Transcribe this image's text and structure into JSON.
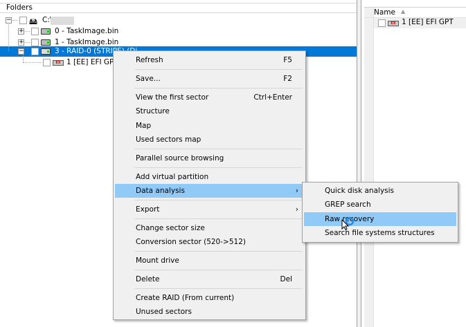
{
  "folders_header": "Folders",
  "tree": [
    {
      "label": "C:\\",
      "expander": "minus"
    },
    {
      "label": "0 - TaskImage.bin",
      "expander": "plus"
    },
    {
      "label": "1 - TaskImage.bin",
      "expander": "plus"
    },
    {
      "label": "3 - RAID-0 (STRIPE) (Di",
      "expander": "minus",
      "selected": true
    },
    {
      "label": "1 [EE] EFI GPT"
    }
  ],
  "list": {
    "column": "Name",
    "sort": "ascending",
    "rows": [
      {
        "label": "1 [EE] EFI GPT"
      }
    ]
  },
  "context_menu": {
    "items": [
      {
        "label": "Refresh",
        "shortcut": "F5"
      },
      {
        "label": "Save...",
        "shortcut": "F2"
      },
      {
        "label": "View the first sector",
        "shortcut": "Ctrl+Enter"
      },
      {
        "label": "Structure"
      },
      {
        "label": "Map"
      },
      {
        "label": "Used sectors map"
      },
      {
        "label": "Parallel source browsing"
      },
      {
        "label": "Add virtual partition"
      },
      {
        "label": "Data analysis",
        "submenu": true
      },
      {
        "label": "Export",
        "submenu": true
      },
      {
        "label": "Change sector size"
      },
      {
        "label": "Conversion sector (520->512)"
      },
      {
        "label": "Mount drive"
      },
      {
        "label": "Delete",
        "shortcut": "Del"
      },
      {
        "label": "Create RAID (From current)"
      },
      {
        "label": "Unused sectors"
      }
    ],
    "submenu_arrow": "›"
  },
  "submenu": {
    "items": [
      {
        "label": "Quick disk  analysis"
      },
      {
        "label": "GREP search"
      },
      {
        "label": "Raw recovery"
      },
      {
        "label": "Search file systems structures"
      }
    ]
  },
  "colors": {
    "selection": "#0078d7",
    "menu_highlight": "#91c9f7",
    "menu_bg": "#f0f0f0"
  }
}
